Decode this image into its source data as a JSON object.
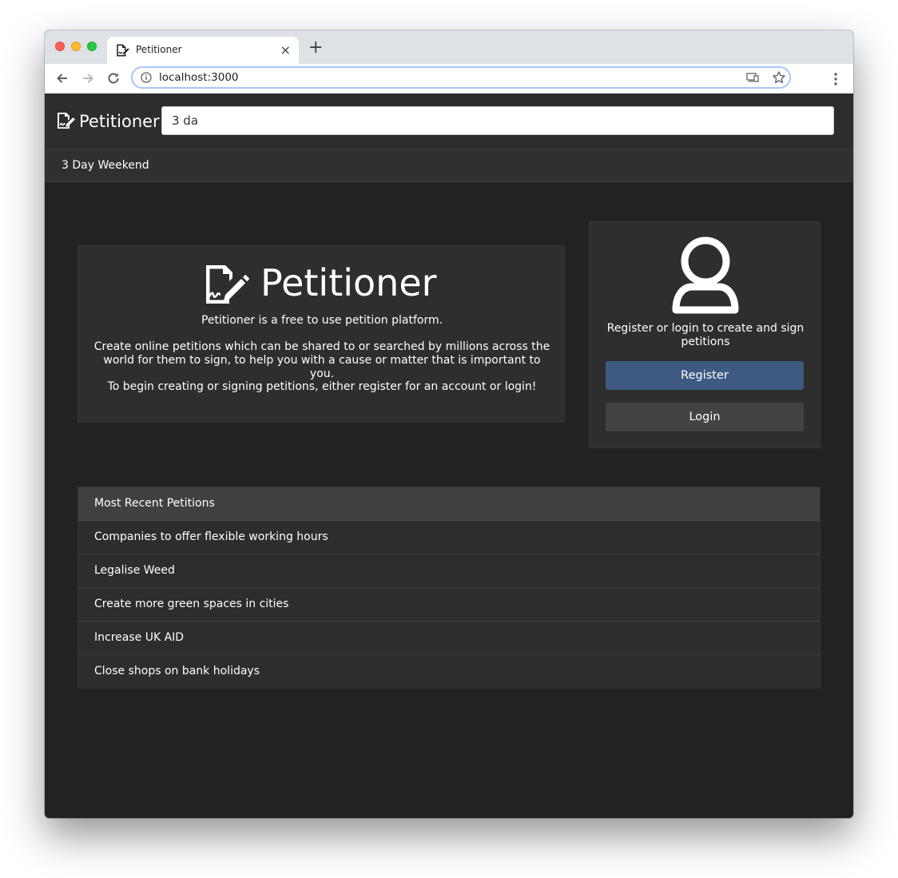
{
  "browser": {
    "tab_title": "Petitioner",
    "tab_close": "×",
    "new_tab": "+",
    "url": "localhost:3000"
  },
  "app": {
    "brand": "Petitioner",
    "search": {
      "value": "3 da",
      "suggestions": [
        "3 Day Weekend"
      ]
    }
  },
  "hero": {
    "title": "Petitioner",
    "tagline": "Petitioner is a free to use petition platform.",
    "body": "Create online petitions which can be shared to or searched by millions across the world for them to sign, to help you with a cause or matter that is important to you.",
    "cta": "To begin creating or signing petitions, either register for an account or login!"
  },
  "auth": {
    "prompt": "Register or login to create and sign petitions",
    "register_label": "Register",
    "login_label": "Login",
    "register_color": "#3e5a82"
  },
  "recent_petitions": {
    "header": "Most Recent Petitions",
    "items": [
      "Companies to offer flexible working hours",
      "Legalise Weed",
      "Create more green spaces in cities",
      "Increase UK AID",
      "Close shops on bank holidays"
    ]
  },
  "icons": {
    "brand": "file-signature-icon",
    "avatar": "user-icon",
    "nav": [
      "back-arrow-icon",
      "forward-arrow-icon",
      "reload-icon"
    ],
    "omnibox": [
      "info-icon",
      "cast-icon",
      "star-icon"
    ],
    "menu": "more-vert-icon"
  },
  "colors": {
    "page_bg": "#222222",
    "navbar_bg": "#2d2d2d",
    "panel_bg": "#2e2e2e"
  }
}
